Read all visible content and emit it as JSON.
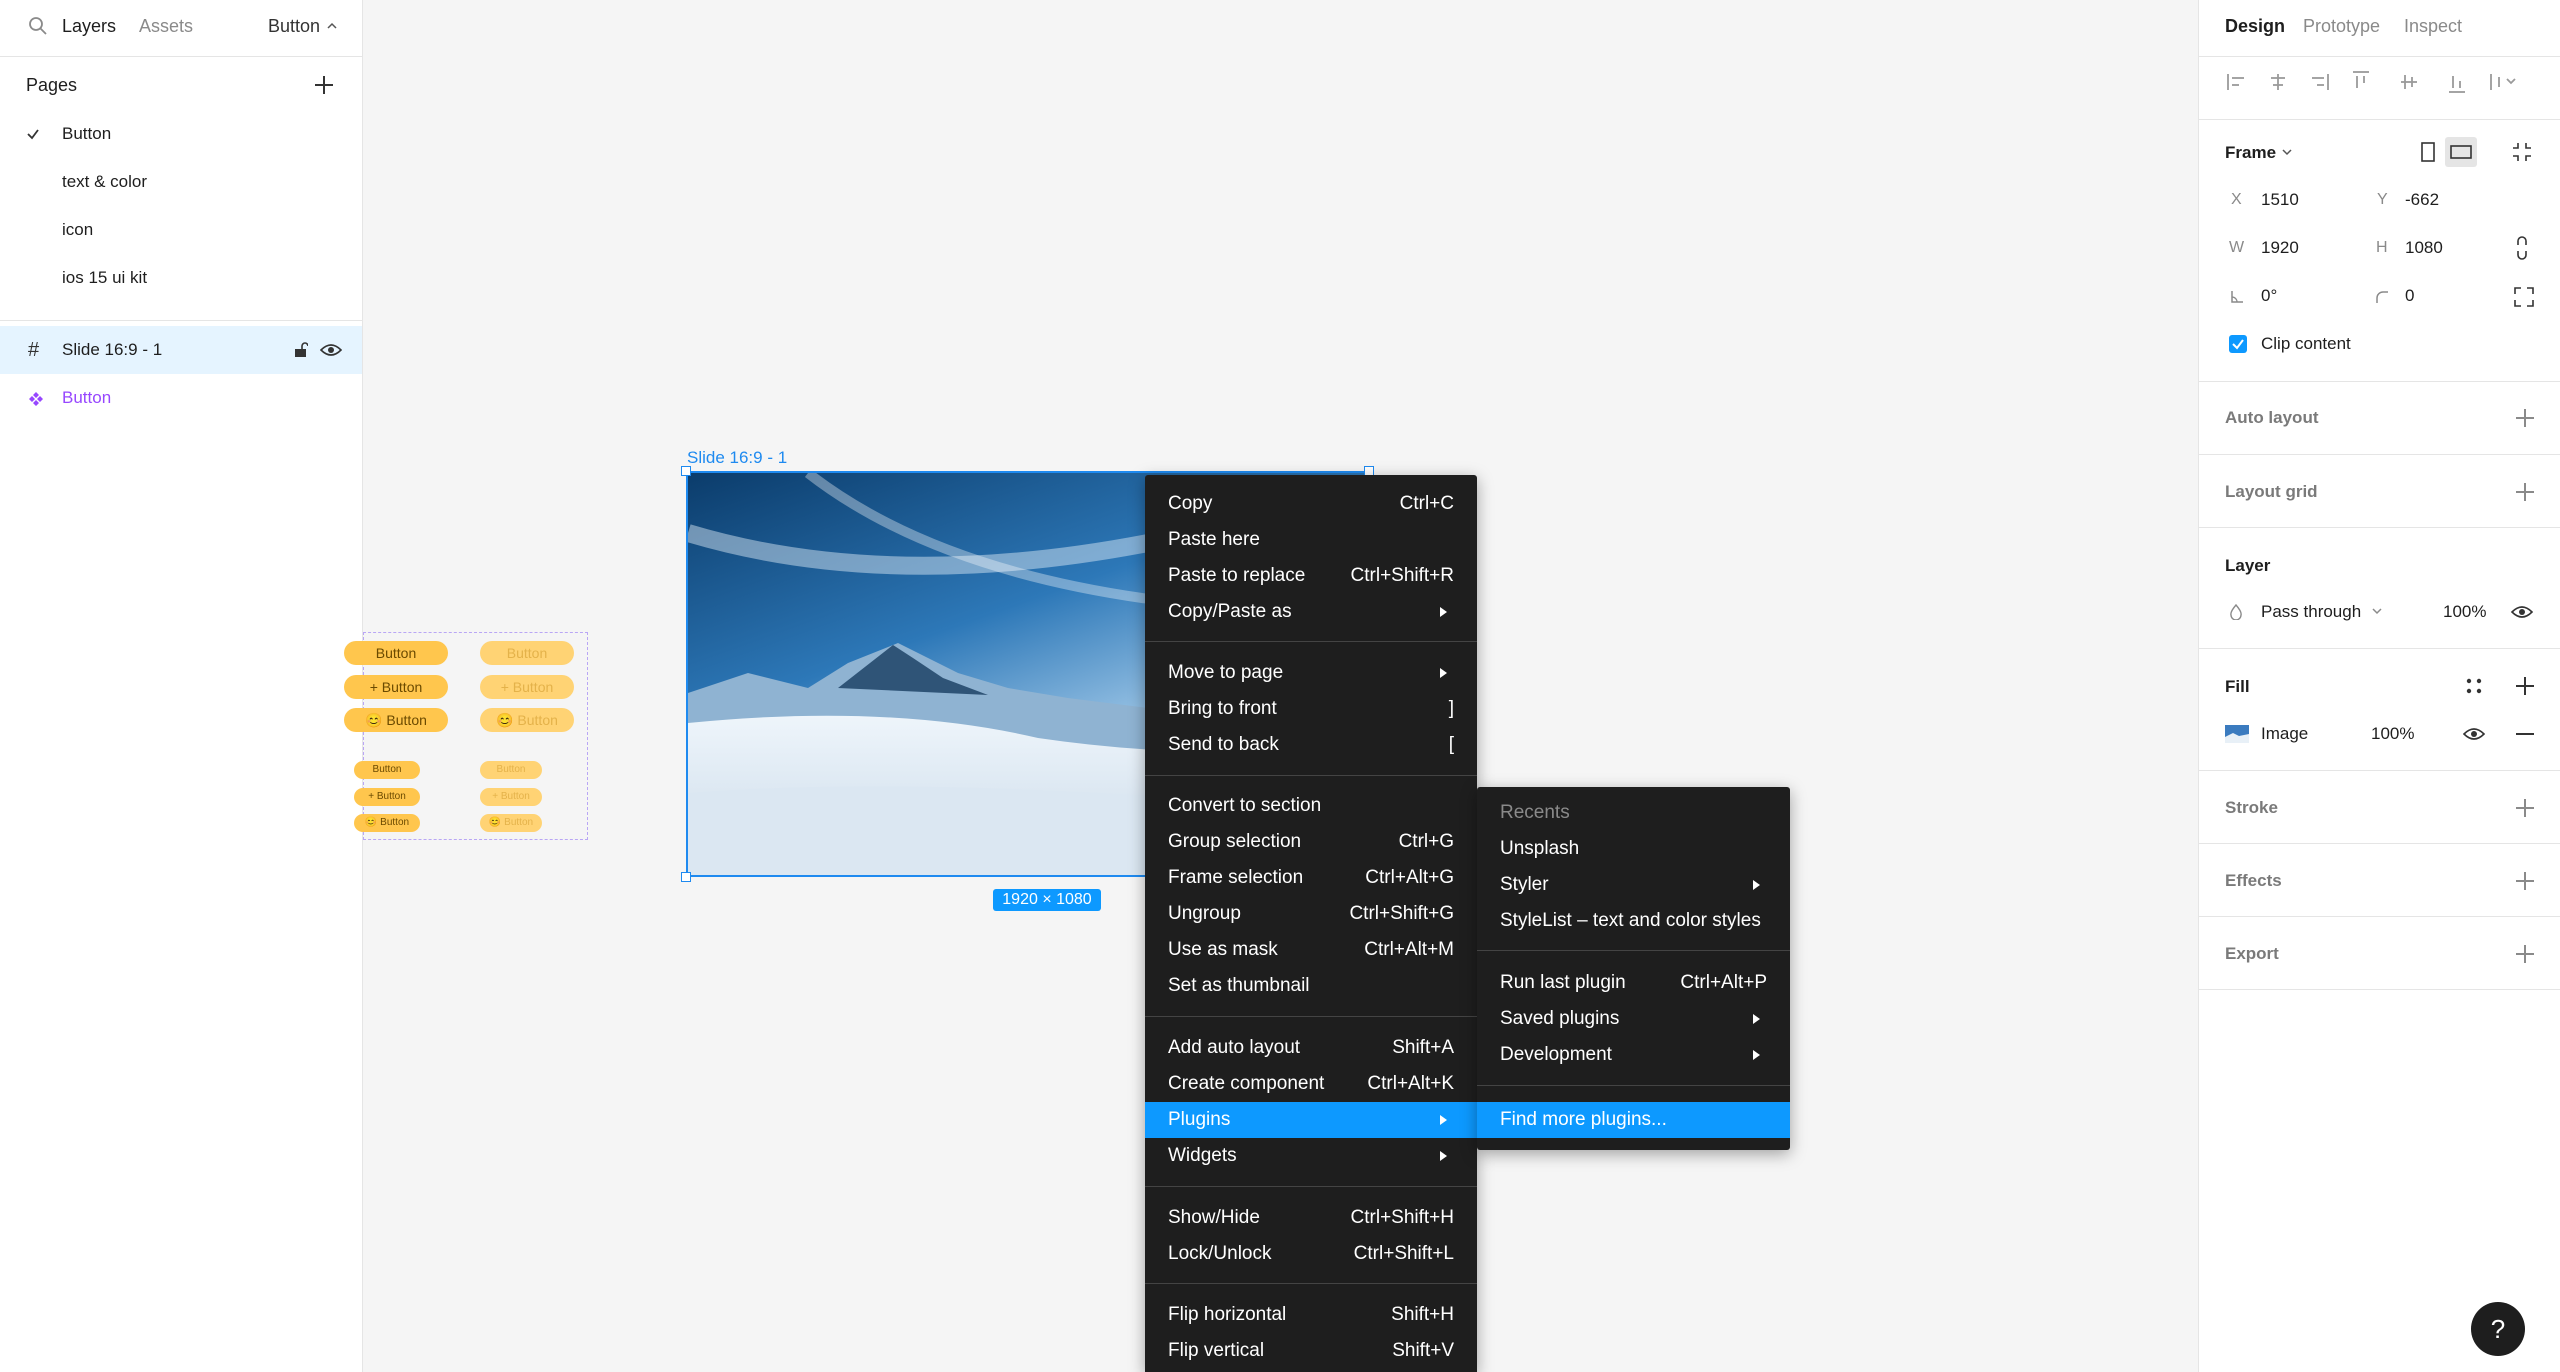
{
  "left_panel": {
    "tabs": {
      "layers": "Layers",
      "assets": "Assets",
      "page_switch": "Button"
    },
    "pages_title": "Pages",
    "pages": [
      {
        "label": "Button",
        "current": true
      },
      {
        "label": "text & color"
      },
      {
        "label": "icon"
      },
      {
        "label": "ios 15 ui kit"
      }
    ],
    "layers": [
      {
        "label": "Slide 16:9 - 1",
        "type": "frame",
        "selected": true
      },
      {
        "label": "Button",
        "type": "component"
      }
    ]
  },
  "canvas": {
    "frame_label": "Slide 16:9 - 1",
    "size_badge": "1920 × 1080",
    "component_buttons": {
      "label": "Button",
      "plus_label": "+ Button",
      "emoji_label": "😊 Button"
    }
  },
  "context_menu": {
    "groups": [
      [
        {
          "label": "Copy",
          "shortcut": "Ctrl+C"
        },
        {
          "label": "Paste here"
        },
        {
          "label": "Paste to replace",
          "shortcut": "Ctrl+Shift+R"
        },
        {
          "label": "Copy/Paste as",
          "submenu": true
        }
      ],
      [
        {
          "label": "Move to page",
          "submenu": true
        },
        {
          "label": "Bring to front",
          "shortcut": "]"
        },
        {
          "label": "Send to back",
          "shortcut": "["
        }
      ],
      [
        {
          "label": "Convert to section"
        },
        {
          "label": "Group selection",
          "shortcut": "Ctrl+G"
        },
        {
          "label": "Frame selection",
          "shortcut": "Ctrl+Alt+G"
        },
        {
          "label": "Ungroup",
          "shortcut": "Ctrl+Shift+G"
        },
        {
          "label": "Use as mask",
          "shortcut": "Ctrl+Alt+M"
        },
        {
          "label": "Set as thumbnail"
        }
      ],
      [
        {
          "label": "Add auto layout",
          "shortcut": "Shift+A"
        },
        {
          "label": "Create component",
          "shortcut": "Ctrl+Alt+K"
        },
        {
          "label": "Plugins",
          "submenu": true,
          "highlighted": true
        },
        {
          "label": "Widgets",
          "submenu": true
        }
      ],
      [
        {
          "label": "Show/Hide",
          "shortcut": "Ctrl+Shift+H"
        },
        {
          "label": "Lock/Unlock",
          "shortcut": "Ctrl+Shift+L"
        }
      ],
      [
        {
          "label": "Flip horizontal",
          "shortcut": "Shift+H"
        },
        {
          "label": "Flip vertical",
          "shortcut": "Shift+V"
        }
      ]
    ]
  },
  "plugins_submenu": {
    "recents_header": "Recents",
    "recents": [
      {
        "label": "Unsplash"
      },
      {
        "label": "Styler",
        "submenu": true
      },
      {
        "label": "StyleList – text and color styles"
      }
    ],
    "actions": [
      {
        "label": "Run last plugin",
        "shortcut": "Ctrl+Alt+P"
      },
      {
        "label": "Saved plugins",
        "submenu": true
      },
      {
        "label": "Development",
        "submenu": true
      }
    ],
    "find_more": "Find more plugins..."
  },
  "right_panel": {
    "tabs": {
      "design": "Design",
      "prototype": "Prototype",
      "inspect": "Inspect"
    },
    "frame": {
      "title": "Frame",
      "x_label": "X",
      "x": "1510",
      "y_label": "Y",
      "y": "-662",
      "w_label": "W",
      "w": "1920",
      "h_label": "H",
      "h": "1080",
      "rotation": "0°",
      "radius": "0",
      "clip_content": "Clip content"
    },
    "auto_layout": "Auto layout",
    "layout_grid": "Layout grid",
    "layer": {
      "title": "Layer",
      "blend": "Pass through",
      "opacity": "100%"
    },
    "fill": {
      "title": "Fill",
      "type": "Image",
      "opacity": "100%"
    },
    "stroke": "Stroke",
    "effects": "Effects",
    "export": "Export"
  },
  "help_button": "?",
  "colors": {
    "accent": "#0d99ff",
    "menu_bg": "#1e1e1e",
    "selection": "#1e8af0",
    "component": "#9747ff",
    "button_yellow": "#ffc64d"
  }
}
